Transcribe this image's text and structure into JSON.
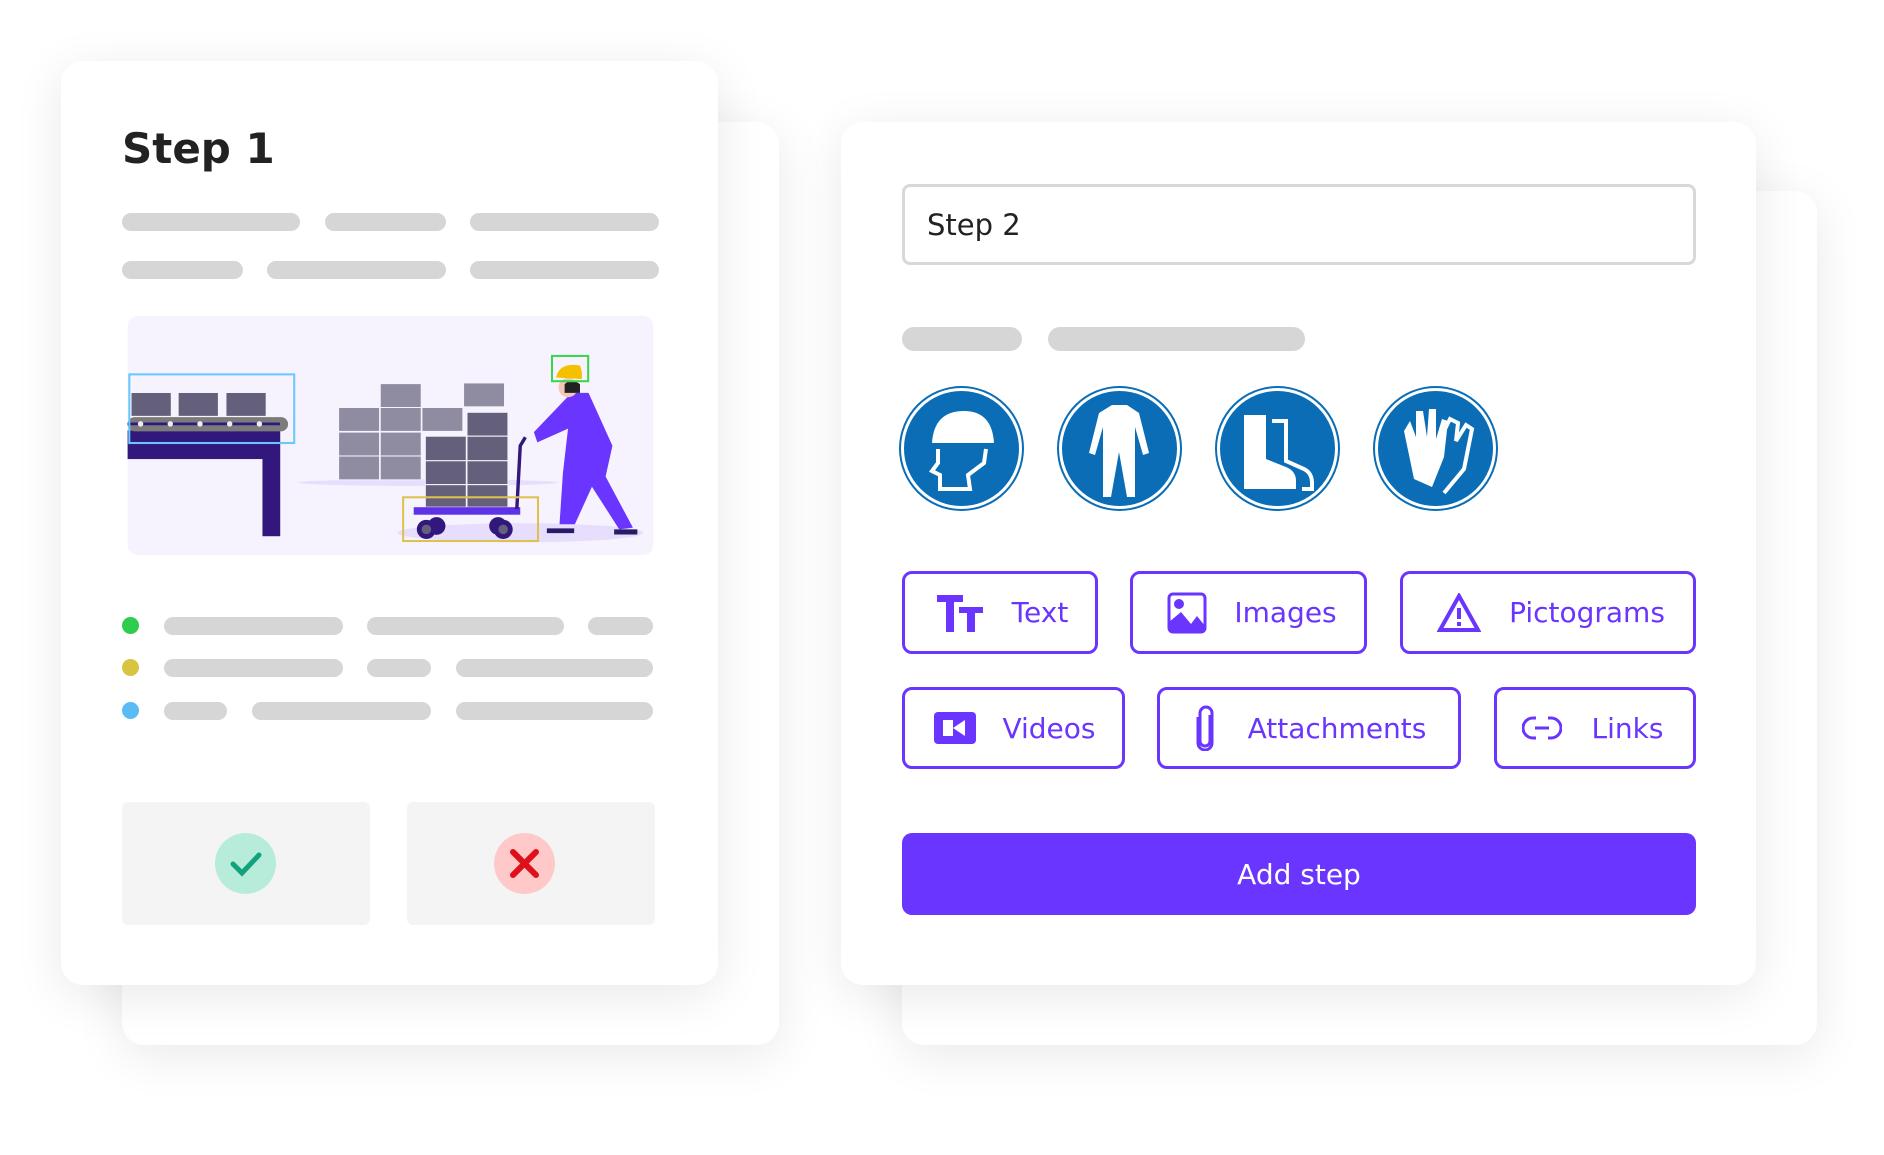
{
  "step1": {
    "title": "Step 1",
    "status_colors": [
      "#2ecc4f",
      "#d9c441",
      "#5bbcf5"
    ]
  },
  "step2": {
    "input_value": "Step 2",
    "pictograms": [
      "hard-hat-icon",
      "protective-suit-icon",
      "safety-boots-icon",
      "gloves-icon"
    ],
    "options": [
      {
        "label": "Text",
        "icon": "text-size-icon"
      },
      {
        "label": "Images",
        "icon": "image-icon"
      },
      {
        "label": "Pictograms",
        "icon": "warning-icon"
      },
      {
        "label": "Videos",
        "icon": "video-icon"
      },
      {
        "label": "Attachments",
        "icon": "paperclip-icon"
      },
      {
        "label": "Links",
        "icon": "link-icon"
      }
    ],
    "add_step_label": "Add step",
    "accent": "#6a35ff",
    "pictogram_color": "#0a6db5"
  }
}
